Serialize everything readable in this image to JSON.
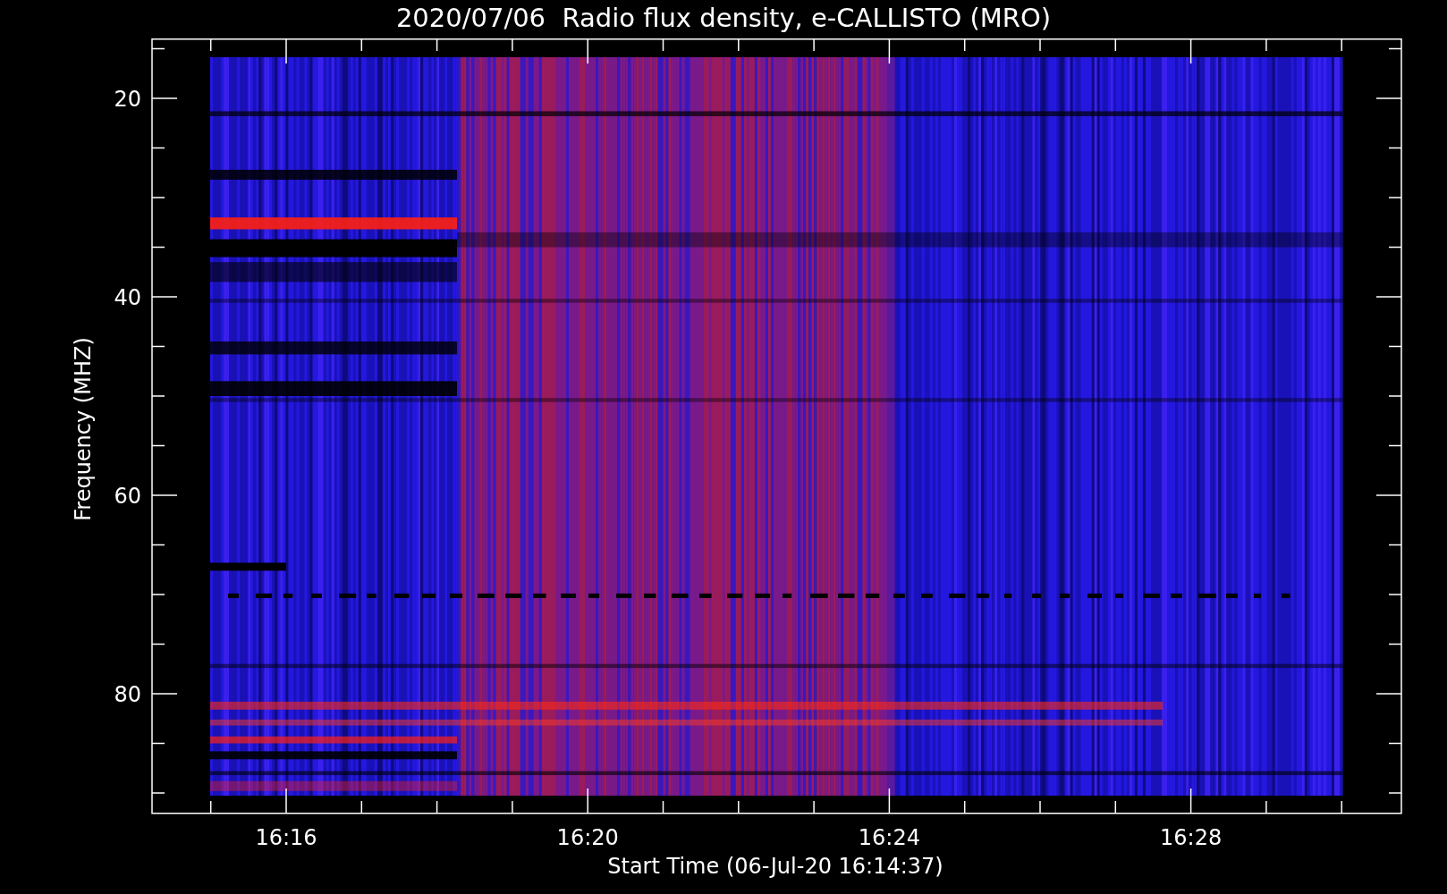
{
  "title": "2020/07/06  Radio flux density, e-CALLISTO (MRO)",
  "y_axis": {
    "label": "Frequency (MHZ)",
    "ticks": [
      "20",
      "40",
      "60",
      "80"
    ]
  },
  "x_axis": {
    "label": "Start Time (06-Jul-20 16:14:37)",
    "ticks": [
      "16:16",
      "16:20",
      "16:24",
      "16:28"
    ]
  }
}
